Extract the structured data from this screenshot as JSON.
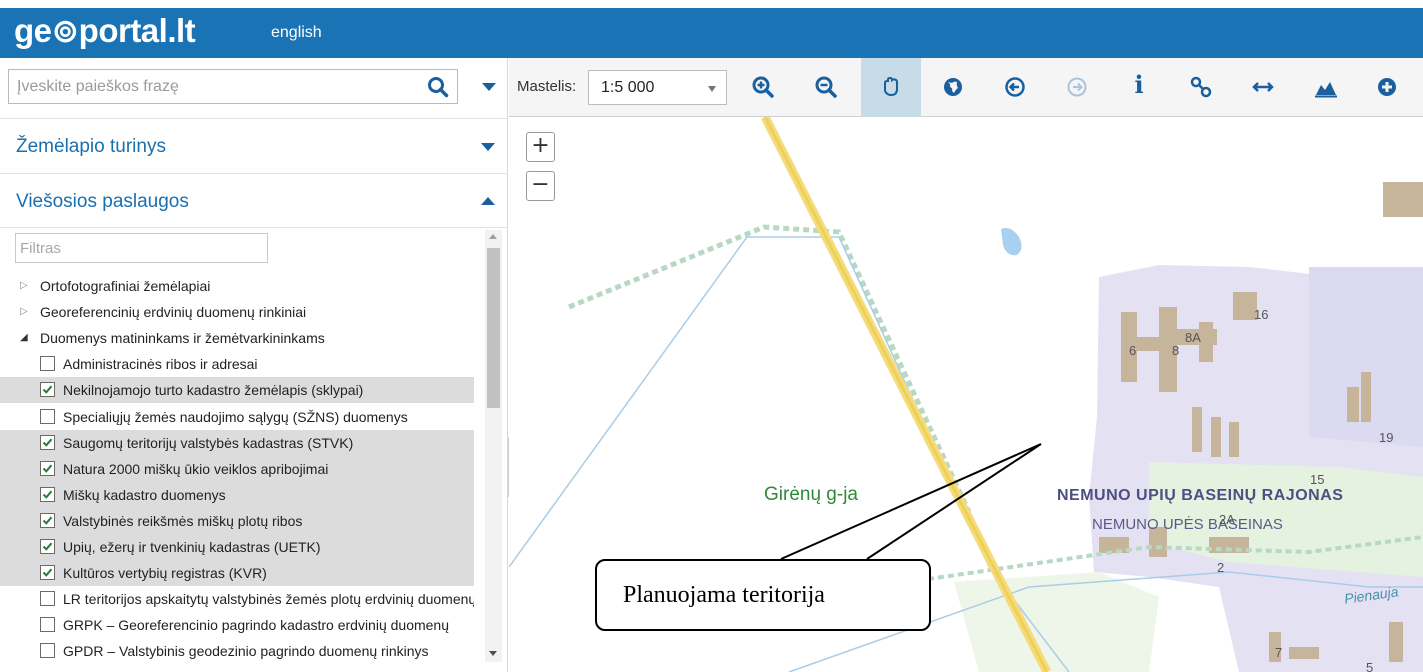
{
  "header": {
    "logo": "ge⊚portal.lt",
    "language": "english",
    "brand_color": "#1a73b4"
  },
  "search": {
    "placeholder": "Įveskite paieškos frazę",
    "value": ""
  },
  "sections": {
    "map_content": "Žemėlapio turinys",
    "public_services": "Viešosios paslaugos"
  },
  "filter": {
    "placeholder": "Filtras"
  },
  "tree": [
    {
      "label": "Ortofotografiniai žemėlapiai",
      "type": "folder",
      "open": false
    },
    {
      "label": "Georeferencinių erdvinių duomenų rinkiniai",
      "type": "folder",
      "open": false
    },
    {
      "label": "Duomenys matininkams ir žemėtvarkininkams",
      "type": "folder",
      "open": true
    },
    {
      "label": "Administracinės ribos ir adresai",
      "type": "layer",
      "checked": false
    },
    {
      "label": "Nekilnojamojo turto kadastro žemėlapis (sklypai)",
      "type": "layer",
      "checked": true
    },
    {
      "label": "Specialiųjų žemės naudojimo sąlygų (SŽNS) duomenys",
      "type": "layer",
      "checked": false
    },
    {
      "label": "Saugomų teritorijų valstybės kadastras (STVK)",
      "type": "layer",
      "checked": true
    },
    {
      "label": "Natura 2000 miškų ūkio veiklos apribojimai",
      "type": "layer",
      "checked": true
    },
    {
      "label": "Miškų kadastro duomenys",
      "type": "layer",
      "checked": true
    },
    {
      "label": "Valstybinės reikšmės miškų plotų ribos",
      "type": "layer",
      "checked": true
    },
    {
      "label": "Upių, ežerų ir tvenkinių kadastras (UETK)",
      "type": "layer",
      "checked": true
    },
    {
      "label": "Kultūros vertybių registras (KVR)",
      "type": "layer",
      "checked": true
    },
    {
      "label": "LR teritorijos apskaitytų valstybinės žemės plotų erdvinių duomenų",
      "type": "layer",
      "checked": false
    },
    {
      "label": "GRPK – Georeferencinio pagrindo kadastro erdvinių duomenų",
      "type": "layer",
      "checked": false
    },
    {
      "label": "GPDR – Valstybinis geodezinio pagrindo duomenų rinkinys",
      "type": "layer",
      "checked": false
    }
  ],
  "toolbar": {
    "scale_label": "Mastelis:",
    "scale_value": "1:5 000",
    "tools": [
      "zoom-in",
      "zoom-out",
      "pan",
      "globe",
      "previous-extent",
      "next-extent",
      "info",
      "link",
      "measure",
      "profile",
      "add"
    ]
  },
  "map": {
    "zoom_in": "+",
    "zoom_out": "−",
    "street": "Girėnų g-ja",
    "district": "NEMUNO UPIŲ BASEINŲ RAJONAS",
    "basin": "NEMUNO UPĖS BASEINAS",
    "river": "Pienauja",
    "numbers": [
      "16",
      "6",
      "8",
      "8A",
      "19",
      "2",
      "2A",
      "15",
      "7",
      "5"
    ],
    "callout": "Planuojama teritorija"
  }
}
